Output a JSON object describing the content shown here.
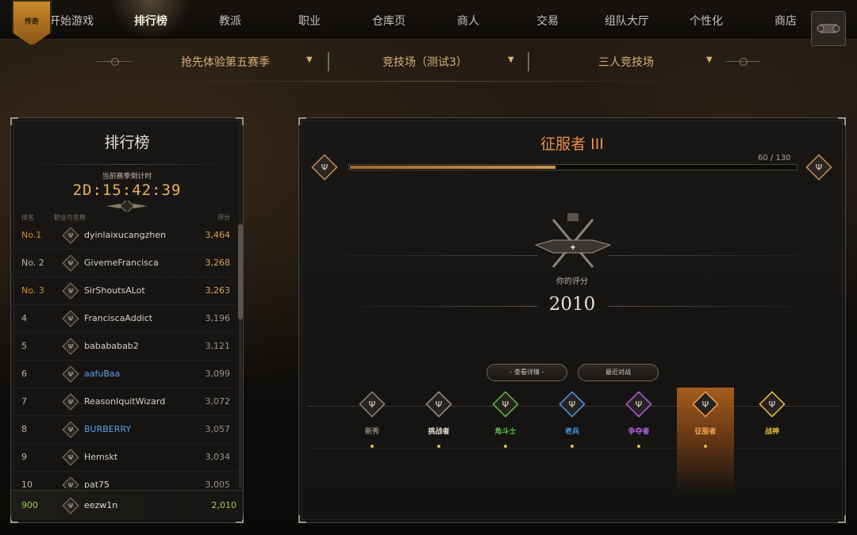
{
  "nav": {
    "badge_text": "传奇",
    "items": [
      "开始游戏",
      "排行榜",
      "教派",
      "职业",
      "仓库页",
      "商人",
      "交易",
      "组队大厅",
      "个性化",
      "商店"
    ]
  },
  "filters": {
    "season": "抢先体验第五赛季",
    "mode": "竞技场（测试3）",
    "bracket": "三人竞技场"
  },
  "leaderboard": {
    "title": "排行榜",
    "timer_label": "当前赛季倒计时",
    "timer": "2D:15:42:39",
    "col_rank": "排名",
    "col_name": "职业与名称",
    "col_score": "评分",
    "rows": [
      {
        "rank": "No.1",
        "name": "dyinlaixucangzhen",
        "score": "3,464"
      },
      {
        "rank": "No. 2",
        "name": "GivemeFrancisca",
        "score": "3,268"
      },
      {
        "rank": "No. 3",
        "name": "SirShoutsALot",
        "score": "3,263"
      },
      {
        "rank": "4",
        "name": "FranciscaAddict",
        "score": "3,196"
      },
      {
        "rank": "5",
        "name": "babababab2",
        "score": "3,121"
      },
      {
        "rank": "6",
        "name": "aafuBaa",
        "score": "3,099"
      },
      {
        "rank": "7",
        "name": "ReasonIquitWizard",
        "score": "3,072"
      },
      {
        "rank": "8",
        "name": "BURBERRY",
        "score": "3,057"
      },
      {
        "rank": "9",
        "name": "Hemskt",
        "score": "3,034"
      },
      {
        "rank": "10",
        "name": "pat75",
        "score": "3,005"
      }
    ],
    "me": {
      "rank": "900",
      "name": "eezw1n",
      "score": "2,010"
    }
  },
  "rank_panel": {
    "title": "征服者 III",
    "progress_text": "60 / 130",
    "progress_fraction": 0.46,
    "rating_label": "你的评分",
    "rating": "2010",
    "btn_details": "- 查看详情 -",
    "btn_recent": "最近对战",
    "tiers": [
      {
        "name": "新秀",
        "color": "#8a8478",
        "dot": true
      },
      {
        "name": "挑战者",
        "color": "#e6dfd2",
        "dot": true
      },
      {
        "name": "角斗士",
        "color": "#5ac040",
        "dot": true
      },
      {
        "name": "老兵",
        "color": "#4a9ae8",
        "dot": true
      },
      {
        "name": "争夺者",
        "color": "#b060e0",
        "dot": true
      },
      {
        "name": "征服者",
        "color": "#f0a050",
        "dot": true
      },
      {
        "name": "战神",
        "color": "#f0c040",
        "dot": false
      }
    ]
  },
  "colors": {
    "accent_orange": "#e89048",
    "gold": "#e0a050",
    "green": "#9ad04a",
    "blue": "#5aa0e8"
  }
}
